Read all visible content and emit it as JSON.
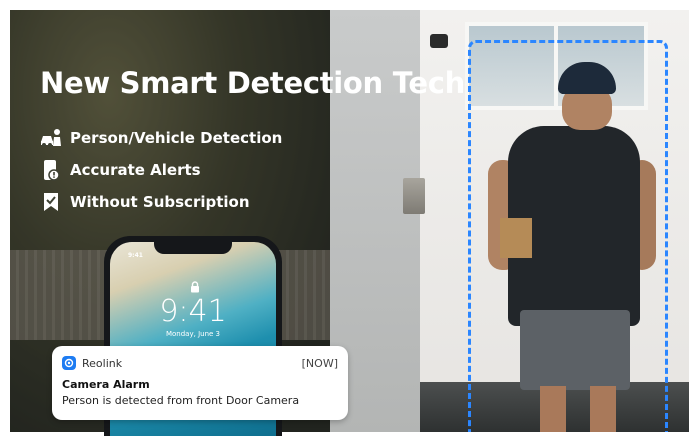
{
  "headline": "New Smart Detection Tech",
  "features": [
    {
      "icon": "person-vehicle-icon",
      "label": "Person/Vehicle Detection"
    },
    {
      "icon": "alert-phone-icon",
      "label": "Accurate Alerts"
    },
    {
      "icon": "bookmark-check-icon",
      "label": "Without Subscription"
    }
  ],
  "phone": {
    "status_time": "9:41",
    "lock_time": "9:41",
    "lock_date": "Monday, June 3"
  },
  "notification": {
    "app_name": "Reolink",
    "time": "[NOW]",
    "title": "Camera Alarm",
    "body": "Person is detected from front Door Camera"
  },
  "colors": {
    "detection_box": "#2b86ff",
    "app_icon": "#1e7cf2"
  }
}
